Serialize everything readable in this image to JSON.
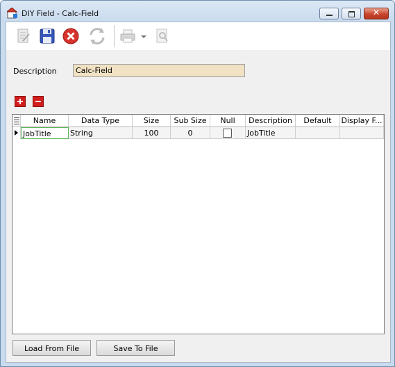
{
  "window": {
    "title": "DIY Field - Calc-Field"
  },
  "toolbar": {
    "icons": [
      "edit-icon",
      "save-icon",
      "cancel-icon",
      "refresh-icon",
      "print-icon",
      "print-dropdown-icon",
      "print-preview-icon"
    ]
  },
  "form": {
    "description_label": "Description",
    "description_value": "Calc-Field"
  },
  "grid": {
    "columns": [
      "Name",
      "Data Type",
      "Size",
      "Sub Size",
      "Null",
      "Description",
      "Default",
      "Display F..."
    ],
    "rows": [
      {
        "name": "JobTitle",
        "data_type": "String",
        "size": "100",
        "sub_size": "0",
        "null": false,
        "description": "JobTitle",
        "default": "",
        "display_format": ""
      }
    ]
  },
  "footer": {
    "load_label": "Load From File",
    "save_label": "Save To File"
  }
}
